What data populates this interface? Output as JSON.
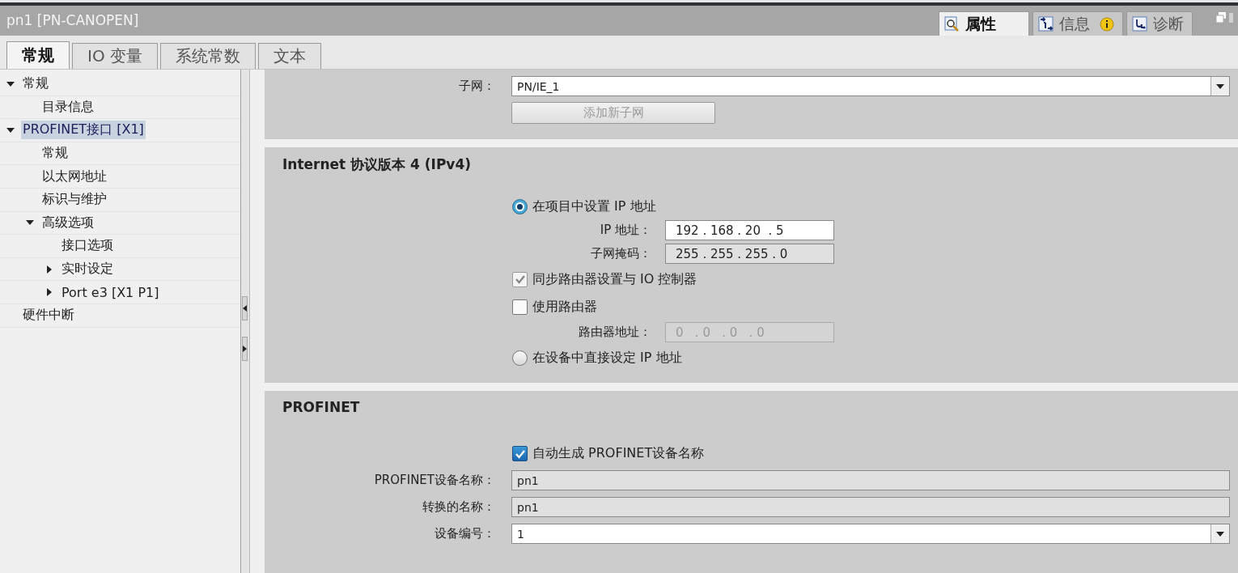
{
  "window": {
    "title": "pn1 [PN-CANOPEN]"
  },
  "inspector_tabs": [
    {
      "label": "属性",
      "selected": true,
      "badge": false
    },
    {
      "label": "信息",
      "selected": false,
      "badge": true
    },
    {
      "label": "诊断",
      "selected": false,
      "badge": false
    }
  ],
  "tabs": [
    {
      "label": "常规",
      "selected": true
    },
    {
      "label": "IO 变量",
      "selected": false
    },
    {
      "label": "系统常数",
      "selected": false
    },
    {
      "label": "文本",
      "selected": false
    }
  ],
  "sidebar": {
    "items": [
      {
        "label": "常规",
        "expanded": true,
        "selected": false,
        "children": [
          {
            "label": "目录信息",
            "selected": false
          }
        ]
      },
      {
        "label": "PROFINET接口 [X1]",
        "expanded": true,
        "selected": true,
        "children": [
          {
            "label": "常规",
            "selected": false
          },
          {
            "label": "以太网地址",
            "selected": false
          },
          {
            "label": "标识与维护",
            "selected": false
          },
          {
            "label": "高级选项",
            "expanded": true,
            "selected": false,
            "children": [
              {
                "label": "接口选项",
                "selected": false
              },
              {
                "label": "实时设定",
                "expanded": false,
                "selected": false
              },
              {
                "label": "Port e3 [X1 P1]",
                "expanded": false,
                "selected": false
              }
            ]
          }
        ]
      },
      {
        "label": "硬件中断",
        "selected": false
      }
    ]
  },
  "subnet": {
    "label": "子网：",
    "value": "PN/IE_1",
    "button": {
      "label": "添加新子网",
      "disabled": true
    }
  },
  "ipv4": {
    "title": "Internet 协议版本 4 (IPv4)",
    "items": [
      {
        "kind": "radio",
        "label": "在项目中设置 IP 地址",
        "selected": true
      },
      {
        "kind": "ip_field",
        "label": "IP 地址：",
        "value": "192 . 168 . 20  . 5",
        "readonly": false,
        "disabled": false
      },
      {
        "kind": "ip_field",
        "label": "子网掩码：",
        "value": "255 . 255 . 255 . 0",
        "readonly": true,
        "disabled": false
      },
      {
        "kind": "checkbox",
        "label": "同步路由器设置与 IO 控制器",
        "checked": true,
        "disabled": true
      },
      {
        "kind": "checkbox",
        "label": "使用路由器",
        "checked": false,
        "disabled": false
      },
      {
        "kind": "ip_field",
        "label": "路由器地址：",
        "value": "0   . 0   . 0   . 0",
        "disabled": true
      },
      {
        "kind": "radio",
        "label": "在设备中直接设定 IP 地址",
        "selected": false
      }
    ]
  },
  "profinet": {
    "title": "PROFINET",
    "auto_name": {
      "label": "自动生成 PROFINET设备名称",
      "checked": true
    },
    "fields": [
      {
        "label": "PROFINET设备名称：",
        "value": "pn1",
        "readonly": true,
        "dropdown": false
      },
      {
        "label": "转换的名称：",
        "value": "pn1",
        "readonly": true,
        "dropdown": false
      },
      {
        "label": "设备编号：",
        "value": "1",
        "readonly": false,
        "dropdown": true
      }
    ]
  }
}
